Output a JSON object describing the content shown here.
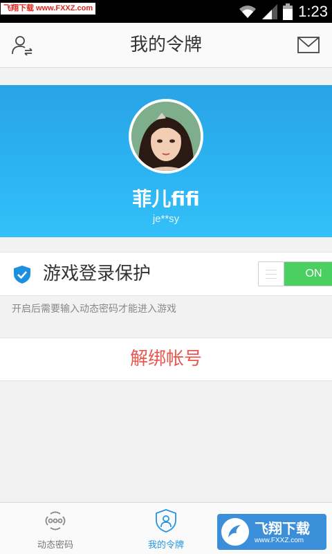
{
  "status_bar": {
    "watermark": "飞翔下载 www.FXXZ.com",
    "time": "1:23",
    "icons": [
      "wifi-icon",
      "signal-icon",
      "battery-icon"
    ]
  },
  "header": {
    "title": "我的令牌",
    "left_icon": "user-switch-icon",
    "right_icon": "mail-icon"
  },
  "profile": {
    "nickname": "菲儿fifi",
    "account": "je**sy"
  },
  "protection": {
    "label": "游戏登录保护",
    "toggle_text": "ON",
    "enabled": true,
    "hint": "开启后需要输入动态密码才能进入游戏"
  },
  "unbind_label": "解绑帐号",
  "bottom_nav": {
    "tabs": [
      {
        "label": "动态密码",
        "icon": "dynamic-password-icon",
        "active": false
      },
      {
        "label": "我的令牌",
        "icon": "token-shield-icon",
        "active": true
      }
    ]
  },
  "watermark_logo": {
    "main": "飞翔下载",
    "sub": "www.FXXZ.com"
  },
  "colors": {
    "accent": "#2196e6",
    "banner": "#2bb3f2",
    "toggle_on": "#4ccf61",
    "danger": "#e8564d"
  }
}
